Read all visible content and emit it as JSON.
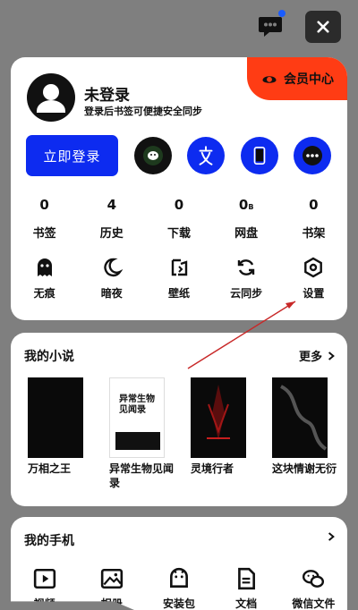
{
  "header": {
    "message_icon": "message-icon",
    "close_icon": "close-icon"
  },
  "account": {
    "username": "未登录",
    "subtitle": "登录后书签可便捷安全同步",
    "vip_label": "会员中心",
    "login_label": "立即登录",
    "quick_logins": [
      "wechat-icon",
      "baidu-icon",
      "phone-icon",
      "more-icon"
    ],
    "stats": [
      {
        "value": "0",
        "label": "书签"
      },
      {
        "value": "4",
        "label": "历史"
      },
      {
        "value": "0",
        "label": "下载"
      },
      {
        "value": "0",
        "unit": "B",
        "label": "网盘"
      },
      {
        "value": "0",
        "label": "书架"
      }
    ],
    "tools": [
      {
        "label": "无痕",
        "icon": "ghost-icon"
      },
      {
        "label": "暗夜",
        "icon": "moon-icon"
      },
      {
        "label": "壁纸",
        "icon": "wallpaper-icon"
      },
      {
        "label": "云同步",
        "icon": "sync-icon"
      },
      {
        "label": "设置",
        "icon": "settings-icon"
      }
    ]
  },
  "novels": {
    "title": "我的小说",
    "more": "更多",
    "books": [
      {
        "name": "万相之王"
      },
      {
        "name": "异常生物见闻录",
        "cover_text": "异常生物见闻录"
      },
      {
        "name": "灵境行者"
      },
      {
        "name": "这块情谢无衍"
      }
    ]
  },
  "phone": {
    "title": "我的手机",
    "items": [
      {
        "label": "视频",
        "icon": "video-icon"
      },
      {
        "label": "相册",
        "icon": "photo-icon"
      },
      {
        "label": "安装包",
        "icon": "apk-icon"
      },
      {
        "label": "文档",
        "icon": "document-icon"
      },
      {
        "label": "微信文件",
        "icon": "wechat-file-icon"
      }
    ]
  },
  "colors": {
    "accent": "#0d2bf0",
    "vip": "#ff3c14",
    "annotation": "#c82828"
  }
}
